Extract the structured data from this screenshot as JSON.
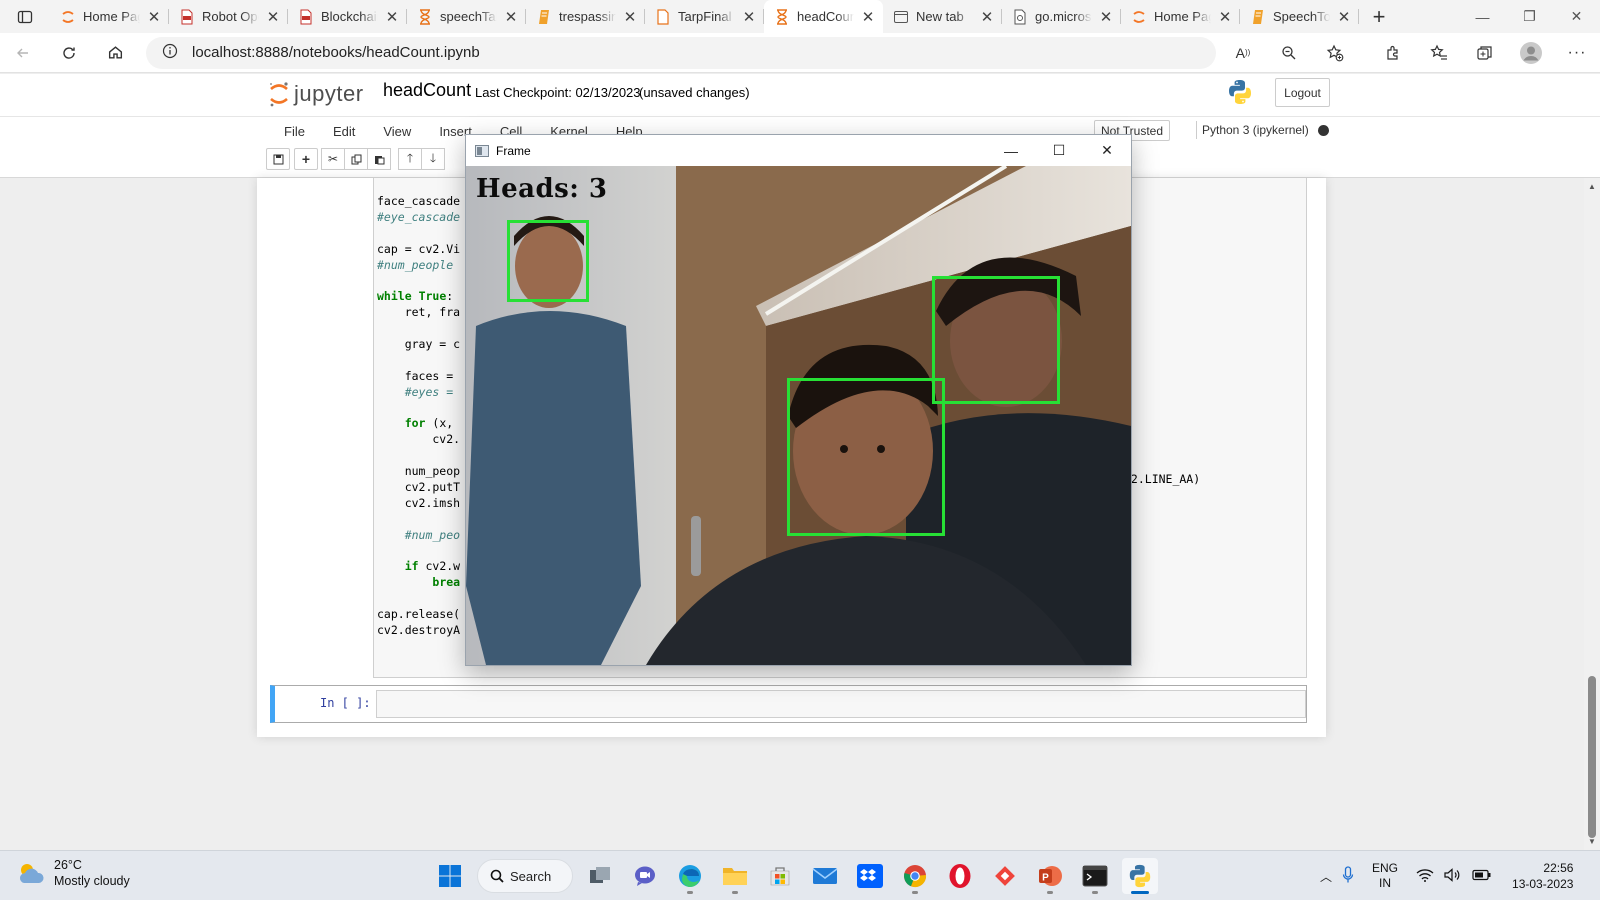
{
  "browser": {
    "tabs": [
      {
        "label": "Home Page",
        "icon": "jupyter-icon"
      },
      {
        "label": "Robot Operation",
        "icon": "pdf-icon"
      },
      {
        "label": "Blockchain",
        "icon": "pdf-icon"
      },
      {
        "label": "speechTab",
        "icon": "hourglass-icon"
      },
      {
        "label": "trespassing",
        "icon": "notebook-icon"
      },
      {
        "label": "TarpFinal",
        "icon": "document-icon"
      },
      {
        "label": "headCount",
        "icon": "hourglass-icon",
        "active": true
      },
      {
        "label": "New tab",
        "icon": "newtab-icon"
      },
      {
        "label": "go.microsoft",
        "icon": "page-icon"
      },
      {
        "label": "Home Page",
        "icon": "jupyter-icon"
      },
      {
        "label": "SpeechTo",
        "icon": "notebook-icon"
      }
    ],
    "close_glyph": "✕",
    "new_tab_glyph": "+",
    "url": "localhost:8888/notebooks/headCount.ipynb"
  },
  "jupyter": {
    "logo_text": "jupyter",
    "notebook_name": "headCount",
    "checkpoint": "Last Checkpoint: 02/13/2023",
    "unsaved": "(unsaved changes)",
    "logout_label": "Logout",
    "menu": [
      "File",
      "Edit",
      "View",
      "Insert",
      "Cell",
      "Kernel",
      "Help"
    ],
    "trust_status": "Not Trusted",
    "kernel_name": "Python 3 (ipykernel)",
    "code_lines": [
      {
        "text": "face_cascade",
        "cls": ""
      },
      {
        "text": "#eye_cascade",
        "cls": "cm"
      },
      {
        "text": "",
        "cls": ""
      },
      {
        "text": "cap = cv2.Vi",
        "cls": ""
      },
      {
        "text": "#num_people",
        "cls": "cm"
      },
      {
        "text": "",
        "cls": ""
      },
      {
        "kw": "while",
        "kw2": "True",
        "rest": ":",
        "cls": "while"
      },
      {
        "text": "    ret, fra",
        "cls": ""
      },
      {
        "text": "",
        "cls": ""
      },
      {
        "text": "    gray = c",
        "cls": ""
      },
      {
        "text": "",
        "cls": ""
      },
      {
        "text": "    faces = ",
        "cls": ""
      },
      {
        "text": "    #eyes = ",
        "cls": "cm"
      },
      {
        "text": "",
        "cls": ""
      },
      {
        "kw": "for",
        "rest": " (x,",
        "indent": "    ",
        "cls": "kwline"
      },
      {
        "text": "        cv2.",
        "cls": ""
      },
      {
        "text": "",
        "cls": ""
      },
      {
        "text": "    num_peop",
        "cls": ""
      },
      {
        "text": "    cv2.putT",
        "cls": ""
      },
      {
        "text": "    cv2.imsh",
        "cls": ""
      },
      {
        "text": "",
        "cls": ""
      },
      {
        "text": "    #num_peo",
        "cls": "cm"
      },
      {
        "text": "",
        "cls": ""
      },
      {
        "kw": "if",
        "rest": " cv2.w",
        "indent": "    ",
        "cls": "kwline"
      },
      {
        "kw": "brea",
        "rest": "",
        "indent": "        ",
        "cls": "kwline"
      },
      {
        "text": "",
        "cls": ""
      },
      {
        "text": "cap.release(",
        "cls": ""
      },
      {
        "text": "cv2.destroyA",
        "cls": ""
      }
    ],
    "code_tail": "v2.LINE_AA)",
    "empty_cell_prompt": "In [ ]:"
  },
  "frame_window": {
    "title": "Frame",
    "overlay_text": "Heads: 3",
    "detected_faces": 3,
    "box_color": "#27e035"
  },
  "taskbar": {
    "temperature": "26°C",
    "weather": "Mostly cloudy",
    "search_label": "Search",
    "language": "ENG",
    "region": "IN",
    "time": "22:56",
    "date": "13-03-2023"
  }
}
